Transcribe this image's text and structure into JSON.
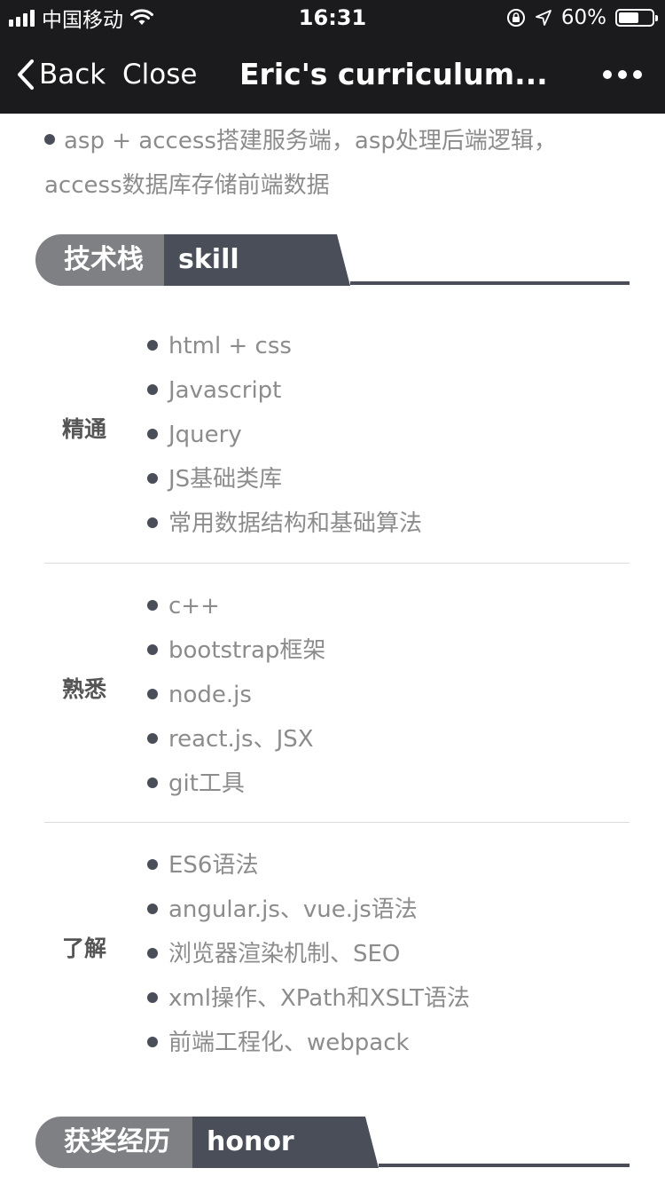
{
  "status_bar": {
    "carrier": "中国移动",
    "time": "16:31",
    "battery": "60%",
    "battery_level": 0.6
  },
  "nav": {
    "back_label": "Back",
    "close_label": "Close",
    "title": "Eric's curriculum..."
  },
  "intro": {
    "text": "asp + access搭建服务端，asp处理后端逻辑，access数据库存储前端数据"
  },
  "skill_section": {
    "title_cn": "技术栈",
    "title_en": "skill",
    "groups": [
      {
        "label": "精通",
        "items": [
          "html + css",
          "Javascript",
          "Jquery",
          "JS基础类库",
          "常用数据结构和基础算法"
        ]
      },
      {
        "label": "熟悉",
        "items": [
          "c++",
          "bootstrap框架",
          "node.js",
          "react.js、JSX",
          "git工具"
        ]
      },
      {
        "label": "了解",
        "items": [
          "ES6语法",
          "angular.js、vue.js语法",
          "浏览器渲染机制、SEO",
          "xml操作、XPath和XSLT语法",
          "前端工程化、webpack"
        ]
      }
    ]
  },
  "honor_section": {
    "title_cn": "获奖经历",
    "title_en": "honor"
  },
  "colors": {
    "nav_background": "#1b1b1d",
    "header_dark": "#4a4e58",
    "header_light": "#7f8084",
    "body_text": "#8c8c8c"
  }
}
